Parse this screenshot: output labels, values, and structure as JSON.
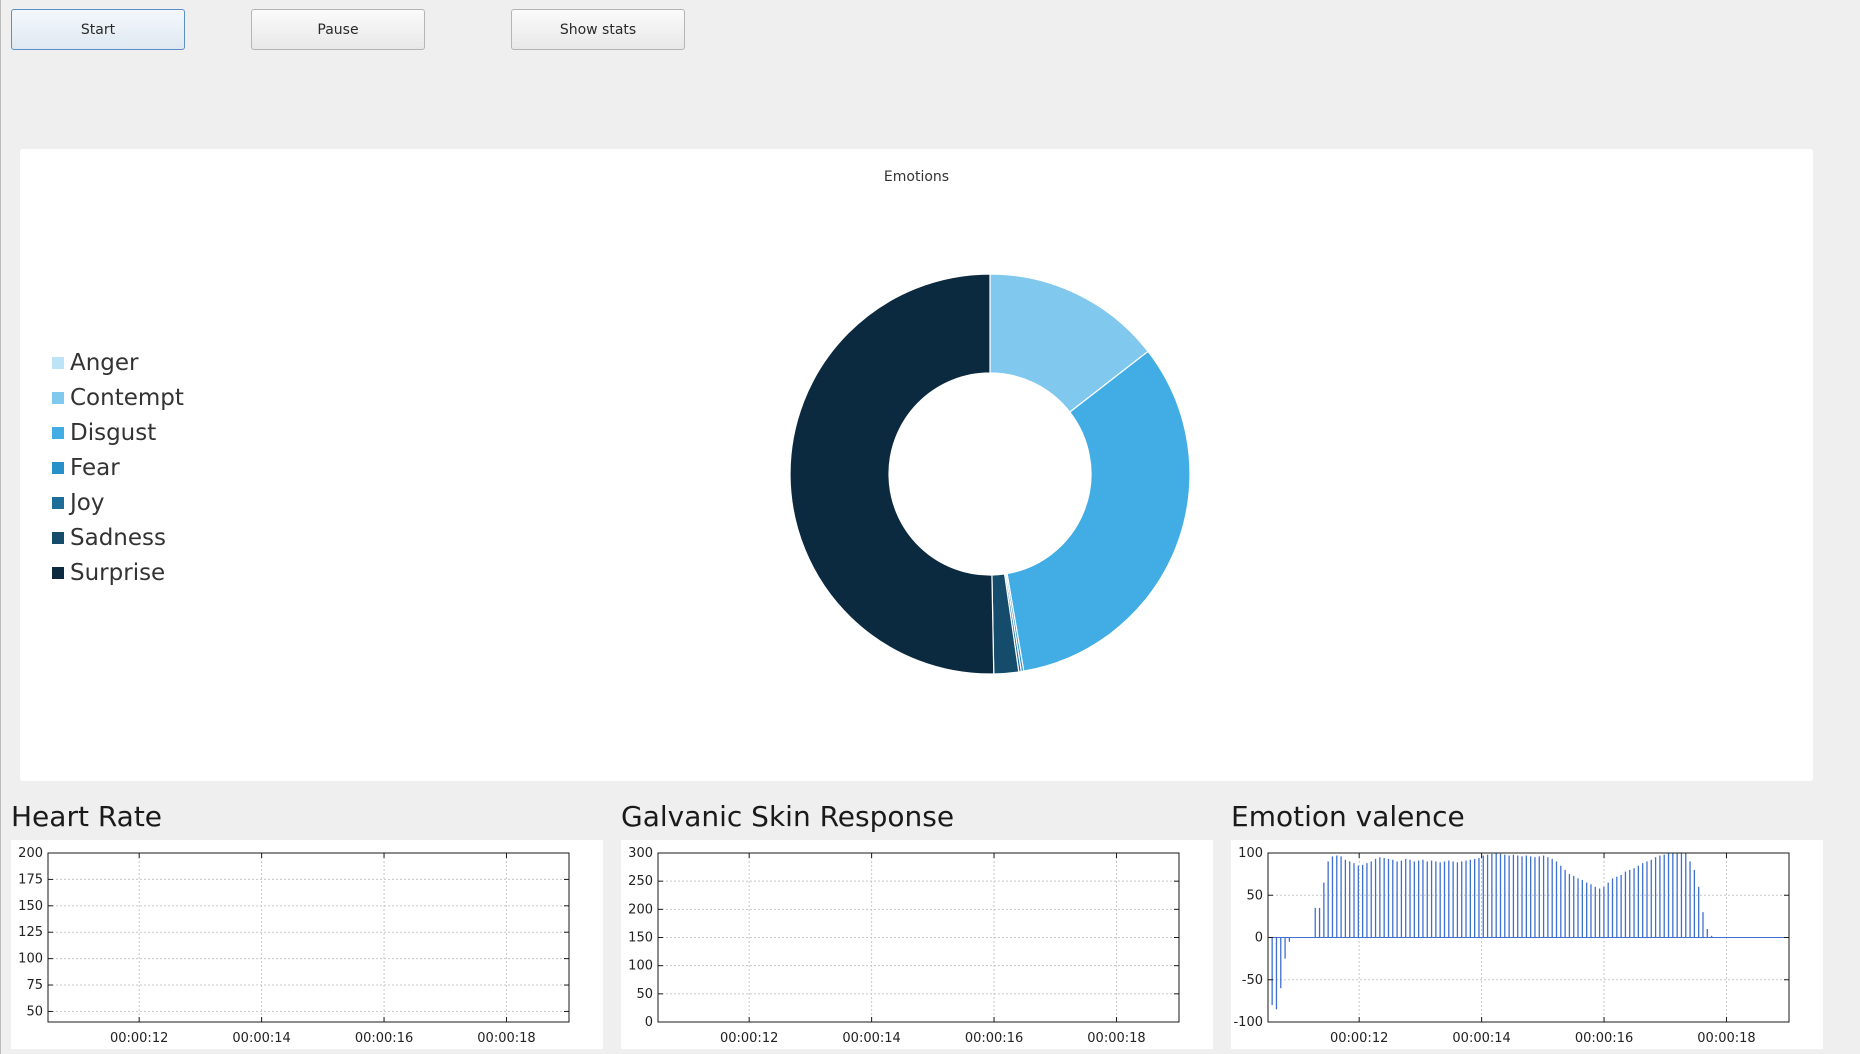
{
  "toolbar": {
    "start_label": "Start",
    "pause_label": "Pause",
    "stats_label": "Show stats"
  },
  "emotions": {
    "title": "Emotions",
    "legend": [
      {
        "label": "Anger",
        "color": "#bde4f6"
      },
      {
        "label": "Contempt",
        "color": "#80c8ee"
      },
      {
        "label": "Disgust",
        "color": "#41ade4"
      },
      {
        "label": "Fear",
        "color": "#2790c8"
      },
      {
        "label": "Joy",
        "color": "#1e6d99"
      },
      {
        "label": "Sadness",
        "color": "#154c6b"
      },
      {
        "label": "Surprise",
        "color": "#0b2a3f"
      }
    ]
  },
  "chart_data": [
    {
      "type": "pie",
      "title": "Emotions",
      "donut": true,
      "legend_position": "left",
      "categories": [
        "Anger",
        "Contempt",
        "Disgust",
        "Fear",
        "Joy",
        "Sadness",
        "Surprise"
      ],
      "values": [
        0,
        14.5,
        32.8,
        0.2,
        0.2,
        2.0,
        50.3
      ]
    },
    {
      "type": "line",
      "title": "Heart Rate",
      "ylim": [
        40,
        200
      ],
      "yticks": [
        200,
        175,
        150,
        125,
        100,
        75,
        50
      ],
      "xticks": [
        "00:00:12",
        "00:00:14",
        "00:00:16",
        "00:00:18"
      ],
      "grid": true,
      "series": []
    },
    {
      "type": "line",
      "title": "Galvanic Skin Response",
      "ylim": [
        0,
        300
      ],
      "yticks": [
        300,
        250,
        200,
        150,
        100,
        50,
        0
      ],
      "xticks": [
        "00:00:12",
        "00:00:14",
        "00:00:16",
        "00:00:18"
      ],
      "grid": true,
      "series": []
    },
    {
      "type": "bar",
      "title": "Emotion valence",
      "ylim": [
        -100,
        100
      ],
      "yticks": [
        100,
        50,
        0,
        -50,
        -100
      ],
      "xticks": [
        "00:00:12",
        "00:00:14",
        "00:00:16",
        "00:00:18"
      ],
      "grid": true,
      "values": [
        -80,
        -85,
        -60,
        -25,
        -5,
        0,
        0,
        0,
        0,
        0,
        35,
        35,
        65,
        90,
        96,
        97,
        96,
        92,
        90,
        88,
        85,
        86,
        88,
        90,
        93,
        95,
        94,
        93,
        92,
        90,
        91,
        93,
        92,
        90,
        91,
        92,
        90,
        91,
        90,
        89,
        90,
        91,
        90,
        89,
        90,
        91,
        92,
        93,
        94,
        97,
        98,
        99,
        100,
        99,
        98,
        97,
        98,
        97,
        96,
        97,
        96,
        95,
        96,
        97,
        95,
        93,
        90,
        85,
        80,
        75,
        73,
        70,
        68,
        65,
        63,
        60,
        58,
        60,
        65,
        70,
        72,
        74,
        78,
        80,
        82,
        85,
        88,
        90,
        92,
        95,
        97,
        98,
        100,
        100,
        100,
        100,
        100,
        90,
        80,
        60,
        30,
        10,
        2,
        0,
        0,
        0,
        0,
        0,
        0,
        0,
        0,
        0,
        0,
        0,
        0,
        0,
        0,
        0,
        0,
        0
      ]
    }
  ],
  "heart_rate": {
    "title": "Heart Rate",
    "yticks": [
      "200",
      "175",
      "150",
      "125",
      "100",
      "75",
      "50"
    ],
    "xticks": [
      "00:00:12",
      "00:00:14",
      "00:00:16",
      "00:00:18"
    ]
  },
  "gsr": {
    "title": "Galvanic Skin Response",
    "yticks": [
      "300",
      "250",
      "200",
      "150",
      "100",
      "50",
      "0"
    ],
    "xticks": [
      "00:00:12",
      "00:00:14",
      "00:00:16",
      "00:00:18"
    ]
  },
  "valence": {
    "title": "Emotion valence",
    "yticks": [
      "100",
      "50",
      "0",
      "-50",
      "-100"
    ],
    "xticks": [
      "00:00:12",
      "00:00:14",
      "00:00:16",
      "00:00:18"
    ],
    "bar_color": "#3f6fd1"
  }
}
